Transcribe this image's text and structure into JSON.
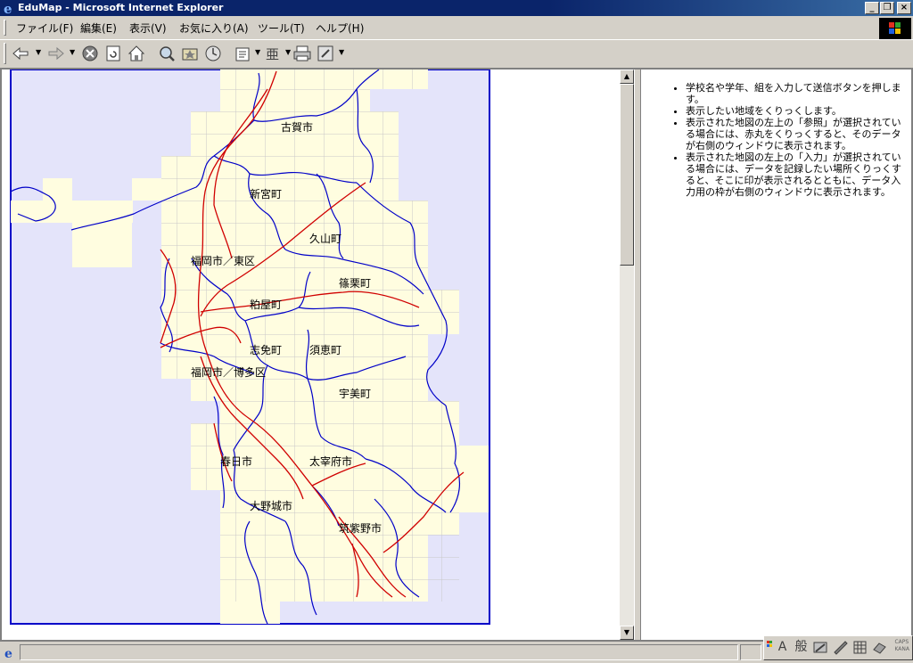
{
  "window": {
    "title": "EduMap - Microsoft Internet Explorer"
  },
  "menu": [
    "ファイル(F)",
    "編集(E)",
    "表示(V)",
    "お気に入り(A)",
    "ツール(T)",
    "ヘルプ(H)"
  ],
  "map": {
    "labels": {
      "koga": "古賀市",
      "shingu": "新宮町",
      "hisayama": "久山町",
      "higashi": "福岡市／東区",
      "sasaguri": "篠栗町",
      "kasuya": "粕屋町",
      "shime": "志免町",
      "sue": "須恵町",
      "hakata": "福岡市／博多区",
      "umi": "宇美町",
      "kasuga": "春日市",
      "dazaifu": "太宰府市",
      "onojo": "大野城市",
      "chikushino": "筑紫野市"
    }
  },
  "instructions": [
    "学校名や学年、組を入力して送信ボタンを押します。",
    "表示したい地域をくりっくします。",
    "表示された地図の左上の「参照」が選択されている場合には、赤丸をくりっくすると、そのデータが右側のウィンドウに表示されます。",
    "表示された地図の左上の「入力」が選択されている場合には、データを記録したい場所くりっくすると、そこに印が表示されるとともに、データ入力用の枠が右側のウィンドウに表示されます。"
  ],
  "ime": {
    "mode": "A",
    "kanji": "般",
    "caps": "CAPS",
    "kana": "KANA"
  },
  "colors": {
    "sea": "#e4e4fa",
    "land": "#fffde0",
    "border": "#0000c8",
    "rail": "#d00000",
    "grid": "#c8c8c8"
  }
}
